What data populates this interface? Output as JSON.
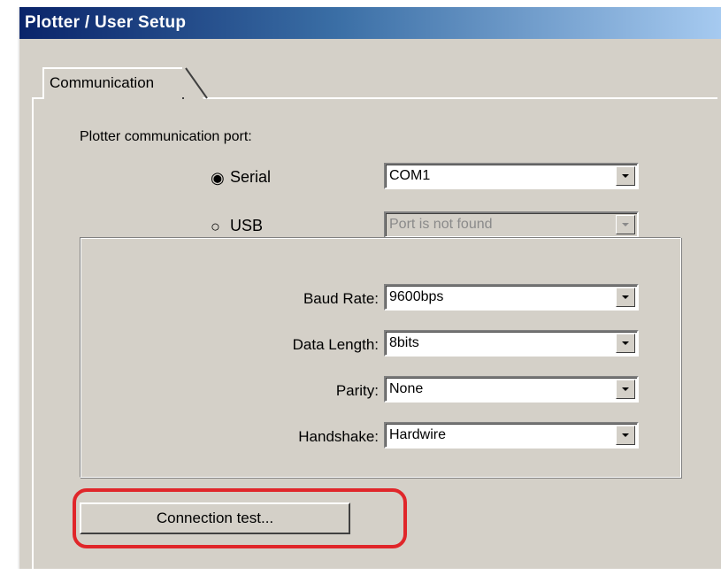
{
  "window": {
    "title": "Plotter / User Setup"
  },
  "tab": {
    "label": "Communication"
  },
  "port": {
    "label": "Plotter communication port:",
    "serial": {
      "label": "Serial",
      "selected": true,
      "value": "COM1"
    },
    "usb": {
      "label": "USB",
      "selected": false,
      "value": "Port is not found",
      "enabled": false
    }
  },
  "settings": {
    "baud_rate": {
      "label": "Baud Rate:",
      "value": "9600bps"
    },
    "data_length": {
      "label": "Data Length:",
      "value": "8bits"
    },
    "parity": {
      "label": "Parity:",
      "value": "None"
    },
    "handshake": {
      "label": "Handshake:",
      "value": "Hardwire"
    }
  },
  "buttons": {
    "connection_test": "Connection test..."
  },
  "colors": {
    "highlight": "#e0262a",
    "titlebar": "#0a246a",
    "dialog": "#d4d0c8"
  }
}
